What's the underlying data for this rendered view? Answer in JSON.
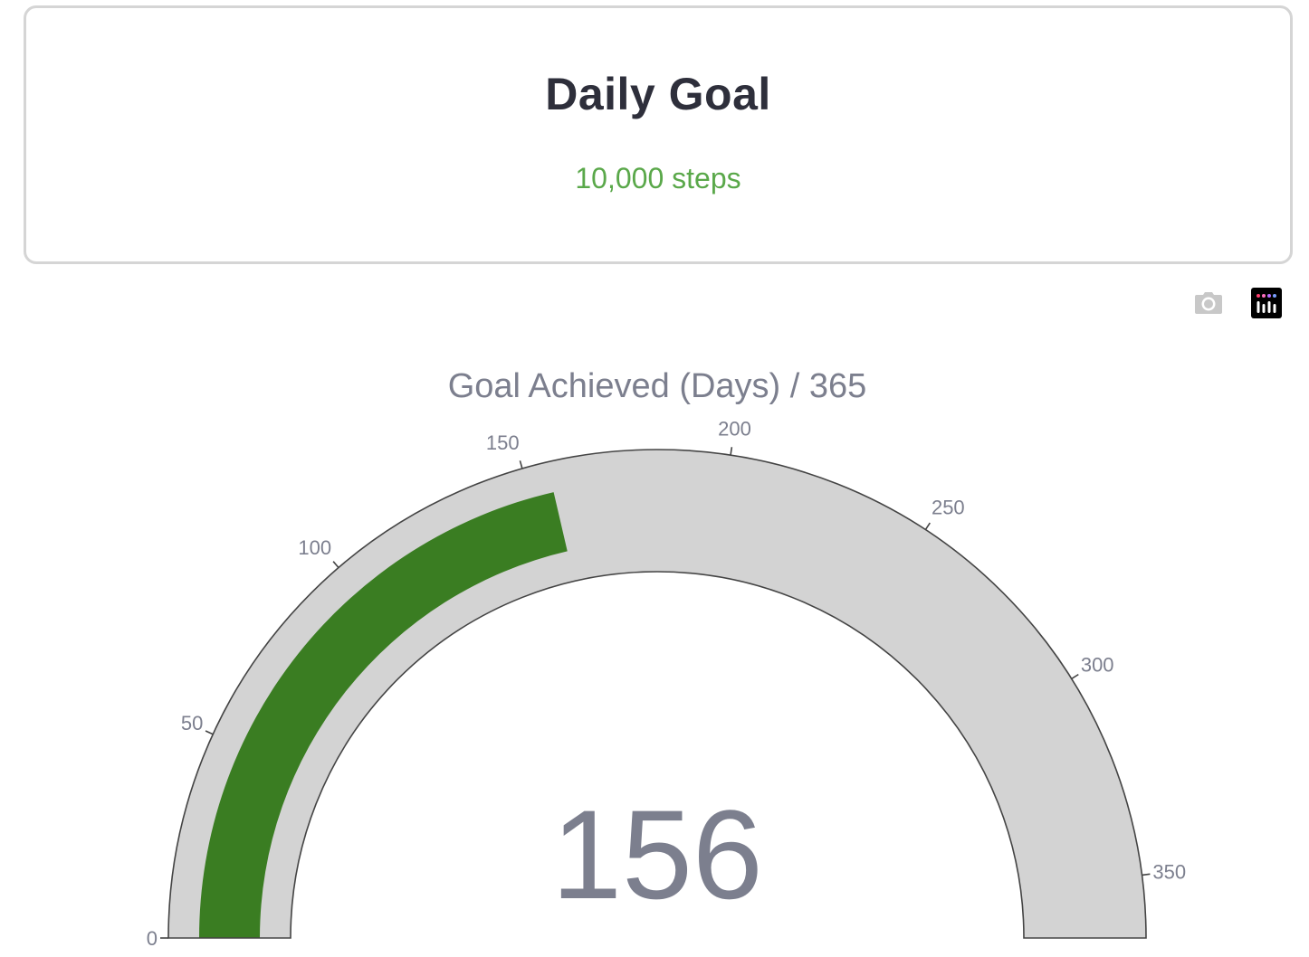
{
  "card": {
    "title": "Daily Goal",
    "subtitle": "10,000 steps",
    "subtitle_color": "#5aa84a"
  },
  "modebar": {
    "icons": [
      "camera-icon",
      "plotly-logo-icon"
    ]
  },
  "chart_data": {
    "type": "gauge",
    "title": "Goal Achieved (Days) / 365",
    "value": 156,
    "value_label": "156",
    "range": [
      0,
      365
    ],
    "ticks": [
      0,
      50,
      100,
      150,
      200,
      250,
      300,
      350
    ],
    "tick_labels": [
      "0",
      "50",
      "100",
      "150",
      "200",
      "250",
      "300",
      "350"
    ],
    "bar_color": "#3a7d22",
    "background_color": "#d3d3d3"
  }
}
